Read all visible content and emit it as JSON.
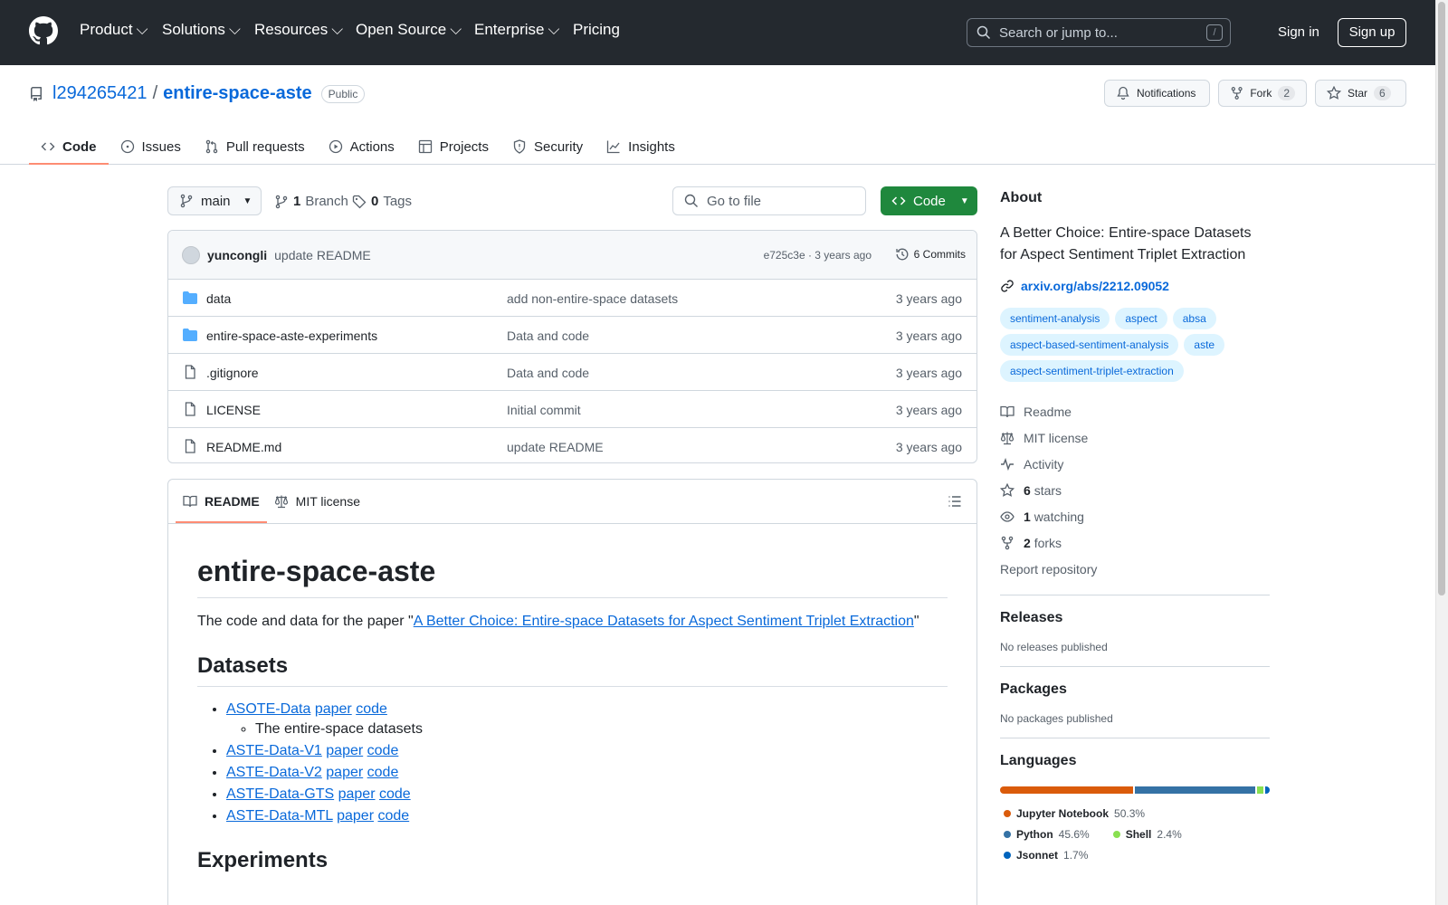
{
  "header": {
    "nav": [
      "Product",
      "Solutions",
      "Resources",
      "Open Source",
      "Enterprise",
      "Pricing"
    ],
    "search_placeholder": "Search or jump to...",
    "search_shortcut": "/",
    "signin": "Sign in",
    "signup": "Sign up"
  },
  "repo": {
    "owner": "l294265421",
    "separator": "/",
    "name": "entire-space-aste",
    "visibility": "Public",
    "notifications": "Notifications",
    "fork_label": "Fork",
    "fork_count": "2",
    "star_label": "Star",
    "star_count": "6",
    "tabs": [
      "Code",
      "Issues",
      "Pull requests",
      "Actions",
      "Projects",
      "Security",
      "Insights"
    ]
  },
  "toolbar": {
    "branch": "main",
    "branch_count": "1",
    "branch_label": "Branch",
    "tag_count": "0",
    "tag_label": "Tags",
    "goto_file": "Go to file",
    "code_button": "Code"
  },
  "commit": {
    "author": "yuncongli",
    "message": "update README",
    "hash_time": "e725c3e · 3 years ago",
    "commits": "6 Commits"
  },
  "files": [
    {
      "name": "data",
      "type": "dir",
      "message": "add non-entire-space datasets",
      "time": "3 years ago"
    },
    {
      "name": "entire-space-aste-experiments",
      "type": "dir",
      "message": "Data and code",
      "time": "3 years ago"
    },
    {
      "name": ".gitignore",
      "type": "file",
      "message": "Data and code",
      "time": "3 years ago"
    },
    {
      "name": "LICENSE",
      "type": "file",
      "message": "Initial commit",
      "time": "3 years ago"
    },
    {
      "name": "README.md",
      "type": "file",
      "message": "update README",
      "time": "3 years ago"
    }
  ],
  "readme": {
    "tab_readme": "README",
    "tab_license": "MIT license",
    "title": "entire-space-aste",
    "intro_prefix": "The code and data for the paper \"",
    "intro_link": "A Better Choice: Entire-space Datasets for Aspect Sentiment Triplet Extraction",
    "intro_suffix": "\"",
    "datasets_heading": "Datasets",
    "datasets": [
      {
        "name": "ASOTE-Data",
        "paper": "paper",
        "code": "code",
        "sub": "The entire-space datasets"
      },
      {
        "name": "ASTE-Data-V1",
        "paper": "paper",
        "code": "code"
      },
      {
        "name": "ASTE-Data-V2",
        "paper": "paper",
        "code": "code"
      },
      {
        "name": "ASTE-Data-GTS",
        "paper": "paper",
        "code": "code"
      },
      {
        "name": "ASTE-Data-MTL",
        "paper": "paper",
        "code": "code"
      }
    ],
    "experiments_heading": "Experiments"
  },
  "about": {
    "heading": "About",
    "description": "A Better Choice: Entire-space Datasets for Aspect Sentiment Triplet Extraction",
    "link": "arxiv.org/abs/2212.09052",
    "topics": [
      "sentiment-analysis",
      "aspect",
      "absa",
      "aspect-based-sentiment-analysis",
      "aste",
      "aspect-sentiment-triplet-extraction"
    ],
    "readme": "Readme",
    "license": "MIT license",
    "activity": "Activity",
    "stars_count": "6",
    "stars_label": "stars",
    "watching_count": "1",
    "watching_label": "watching",
    "forks_count": "2",
    "forks_label": "forks",
    "report": "Report repository"
  },
  "releases": {
    "heading": "Releases",
    "empty": "No releases published"
  },
  "packages": {
    "heading": "Packages",
    "empty": "No packages published"
  },
  "languages": {
    "heading": "Languages",
    "items": [
      {
        "name": "Jupyter Notebook",
        "percent": "50.3%",
        "value": 50.3,
        "color": "#DA5B0B"
      },
      {
        "name": "Python",
        "percent": "45.6%",
        "value": 45.6,
        "color": "#3572A5"
      },
      {
        "name": "Shell",
        "percent": "2.4%",
        "value": 2.4,
        "color": "#89e051"
      },
      {
        "name": "Jsonnet",
        "percent": "1.7%",
        "value": 1.7,
        "color": "#0064bd"
      }
    ]
  }
}
